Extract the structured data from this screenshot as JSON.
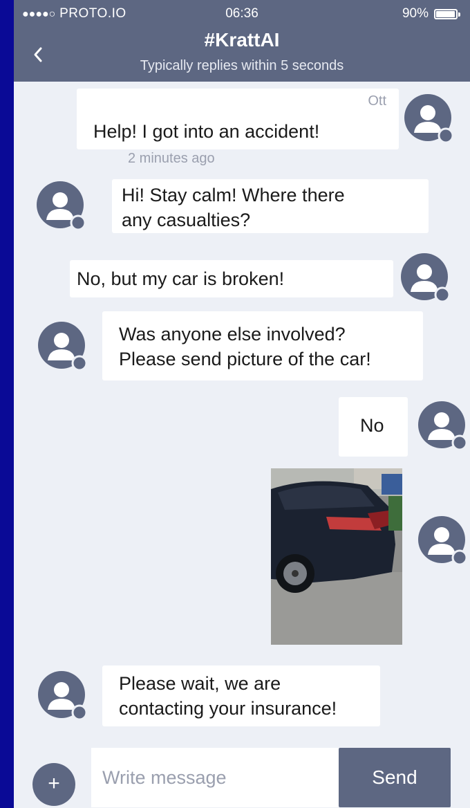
{
  "status_bar": {
    "signal_dots": "●●●●○",
    "carrier": "PROTO.IO",
    "time": "06:36",
    "battery": "90%"
  },
  "header": {
    "back_icon": "chevron-left-icon",
    "title": "#KrattAI",
    "subtitle": "Typically replies within 5 seconds"
  },
  "messages": [
    {
      "sender": "user",
      "name": "Ott",
      "text": "Help! I got into an accident!",
      "time": "2 minutes ago"
    },
    {
      "sender": "bot",
      "text_lines": [
        "Hi! Stay calm! Where there",
        "any casualties?"
      ]
    },
    {
      "sender": "user",
      "text": "No, but my car is broken!"
    },
    {
      "sender": "bot",
      "text_lines": [
        "Was anyone else involved?",
        "Please send picture of the car!"
      ]
    },
    {
      "sender": "user",
      "text": "No"
    },
    {
      "sender": "user",
      "type": "image",
      "image_description": "car-photo"
    },
    {
      "sender": "bot",
      "text_lines": [
        "Please wait, we are",
        "contacting your insurance!"
      ]
    }
  ],
  "composer": {
    "attach_label": "+",
    "placeholder": "Write message",
    "send_label": "Send"
  },
  "colors": {
    "header_bg": "#5d6782",
    "chat_bg": "#edf0f6",
    "bubble_bg": "#ffffff",
    "outer_bg": "#0a0a96"
  }
}
